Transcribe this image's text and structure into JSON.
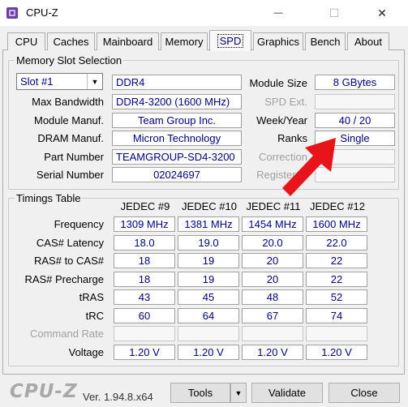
{
  "window": {
    "title": "CPU-Z",
    "minimize_glyph": "—",
    "maximize_glyph": "☐",
    "close_glyph": "✕"
  },
  "tabs": [
    {
      "label": "CPU"
    },
    {
      "label": "Caches"
    },
    {
      "label": "Mainboard"
    },
    {
      "label": "Memory"
    },
    {
      "label": "SPD",
      "active": true
    },
    {
      "label": "Graphics"
    },
    {
      "label": "Bench"
    },
    {
      "label": "About"
    }
  ],
  "memory_slot": {
    "group_label": "Memory Slot Selection",
    "slot_value": "Slot #1",
    "type_value": "DDR4",
    "module_size_label": "Module Size",
    "module_size_value": "8 GBytes",
    "max_bandwidth_label": "Max Bandwidth",
    "max_bandwidth_value": "DDR4-3200 (1600 MHz)",
    "spd_ext_label": "SPD Ext.",
    "spd_ext_value": "",
    "module_manuf_label": "Module Manuf.",
    "module_manuf_value": "Team Group Inc.",
    "week_year_label": "Week/Year",
    "week_year_value": "40 / 20",
    "dram_manuf_label": "DRAM Manuf.",
    "dram_manuf_value": "Micron Technology",
    "ranks_label": "Ranks",
    "ranks_value": "Single",
    "part_number_label": "Part Number",
    "part_number_value": "TEAMGROUP-SD4-3200",
    "correction_label": "Correction",
    "correction_value": "",
    "serial_number_label": "Serial Number",
    "serial_number_value": "02024697",
    "registered_label": "Registered",
    "registered_value": ""
  },
  "timings": {
    "group_label": "Timings Table",
    "columns": [
      "JEDEC #9",
      "JEDEC #10",
      "JEDEC #11",
      "JEDEC #12"
    ],
    "rows": [
      {
        "label": "Frequency",
        "values": [
          "1309 MHz",
          "1381 MHz",
          "1454 MHz",
          "1600 MHz"
        ],
        "enabled": true
      },
      {
        "label": "CAS# Latency",
        "values": [
          "18.0",
          "19.0",
          "20.0",
          "22.0"
        ],
        "enabled": true
      },
      {
        "label": "RAS# to CAS#",
        "values": [
          "18",
          "19",
          "20",
          "22"
        ],
        "enabled": true
      },
      {
        "label": "RAS# Precharge",
        "values": [
          "18",
          "19",
          "20",
          "22"
        ],
        "enabled": true
      },
      {
        "label": "tRAS",
        "values": [
          "43",
          "45",
          "48",
          "52"
        ],
        "enabled": true
      },
      {
        "label": "tRC",
        "values": [
          "60",
          "64",
          "67",
          "74"
        ],
        "enabled": true
      },
      {
        "label": "Command Rate",
        "values": [
          "",
          "",
          "",
          ""
        ],
        "enabled": false
      },
      {
        "label": "Voltage",
        "values": [
          "1.20 V",
          "1.20 V",
          "1.20 V",
          "1.20 V"
        ],
        "enabled": true
      }
    ]
  },
  "footer": {
    "logo": "CPU-Z",
    "version": "Ver. 1.94.8.x64",
    "tools_label": "Tools",
    "validate_label": "Validate",
    "close_label": "Close"
  },
  "colors": {
    "value_text": "#000080",
    "arrow": "#e8141b"
  }
}
